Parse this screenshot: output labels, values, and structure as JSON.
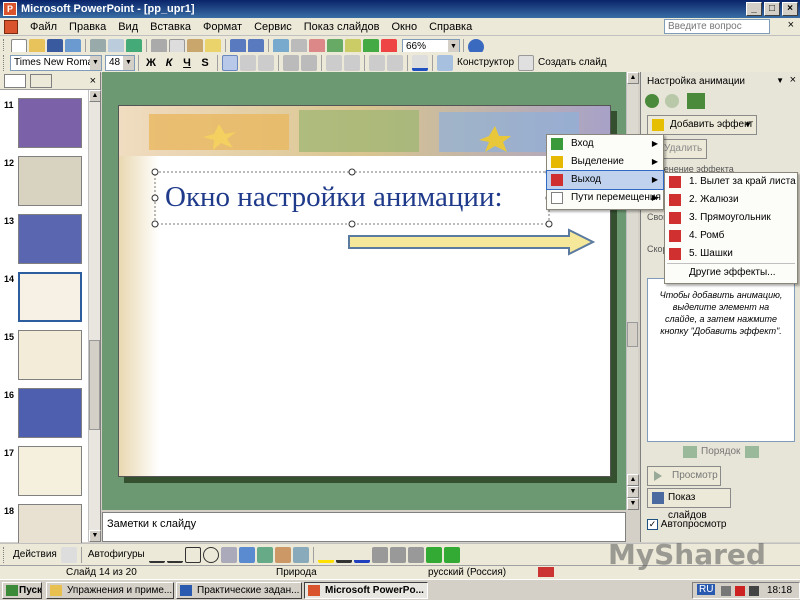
{
  "window": {
    "title": "Microsoft PowerPoint - [pp_upr1]"
  },
  "menu": {
    "items": [
      "Файл",
      "Правка",
      "Вид",
      "Вставка",
      "Формат",
      "Сервис",
      "Показ слайдов",
      "Окно",
      "Справка"
    ],
    "help_placeholder": "Введите вопрос"
  },
  "toolbar": {
    "zoom": "66%"
  },
  "format_toolbar": {
    "font": "Times New Roman",
    "size": "48",
    "bold": "Ж",
    "italic": "К",
    "underline": "Ч",
    "shadow": "S",
    "design": "Конструктор",
    "new_slide": "Создать слайд"
  },
  "slides_pane": {
    "thumbnails": [
      {
        "number": "11",
        "bg": "#7b62a8"
      },
      {
        "number": "12",
        "bg": "#d8d3c0"
      },
      {
        "number": "13",
        "bg": "#5b66b0"
      },
      {
        "number": "14",
        "bg": "#f6f1e4"
      },
      {
        "number": "15",
        "bg": "#f3ecd8"
      },
      {
        "number": "16",
        "bg": "#4f5fb0"
      },
      {
        "number": "17",
        "bg": "#f5efde"
      },
      {
        "number": "18",
        "bg": "#e8e0d0"
      }
    ]
  },
  "slide": {
    "title": "Окно настройки анимации:"
  },
  "notes": {
    "placeholder": "Заметки к слайду"
  },
  "task_pane": {
    "title": "Настройка анимации",
    "add_effect": "Добавить эффект",
    "remove": "Удалить",
    "change_label": "Изменение эффекта",
    "start_label": "Свойство:",
    "speed_label": "Скорость:",
    "hint": "Чтобы добавить анимацию, выделите элемент на слайде, а затем нажмите кнопку \"Добавить эффект\".",
    "order": "Порядок",
    "play": "Просмотр",
    "slideshow": "Показ слайдов",
    "autopreview": "Автопросмотр"
  },
  "effect_menu": {
    "items": [
      {
        "label": "Вход",
        "icon": "entrance-star-icon",
        "color": "#3a9a3a"
      },
      {
        "label": "Выделение",
        "icon": "emphasis-star-icon",
        "color": "#e6b800"
      },
      {
        "label": "Выход",
        "icon": "exit-star-icon",
        "color": "#d03030"
      },
      {
        "label": "Пути перемещения",
        "icon": "motion-path-icon",
        "color": "#808080"
      }
    ]
  },
  "exit_submenu": {
    "items": [
      "1. Вылет за край листа",
      "2. Жалюзи",
      "3. Прямоугольник",
      "4. Ромб",
      "5. Шашки"
    ],
    "more": "Другие эффекты..."
  },
  "draw_toolbar": {
    "actions": "Действия",
    "autoshapes": "Автофигуры"
  },
  "status": {
    "slide": "Слайд 14 из 20",
    "design": "Природа",
    "language": "русский (Россия)"
  },
  "taskbar": {
    "start": "Пуск",
    "buttons": [
      "Упражнения и приме...",
      "Практические задан...",
      "Microsoft PowerPo..."
    ],
    "lang": "RU",
    "time": "18:18"
  },
  "watermark": {
    "text": "MyShared"
  }
}
